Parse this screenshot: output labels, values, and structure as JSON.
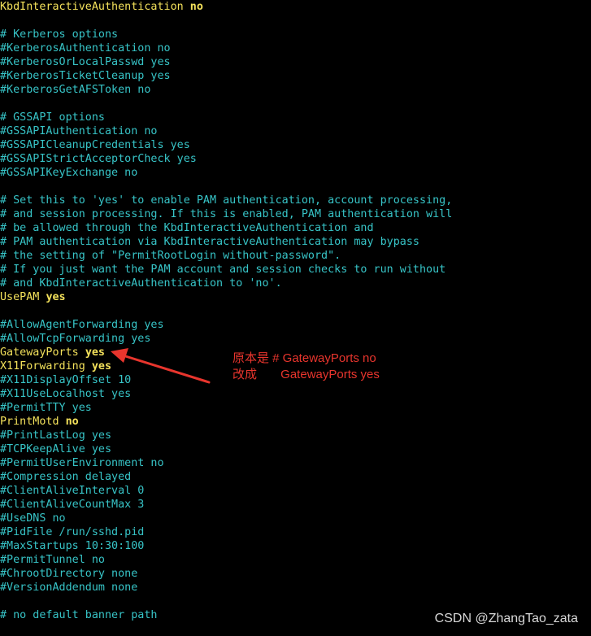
{
  "lines": [
    {
      "type": "directive",
      "key": "KbdInteractiveAuthentication",
      "val": "no"
    },
    {
      "type": "blank",
      "text": ""
    },
    {
      "type": "comment",
      "text": "# Kerberos options"
    },
    {
      "type": "comment",
      "text": "#KerberosAuthentication no"
    },
    {
      "type": "comment",
      "text": "#KerberosOrLocalPasswd yes"
    },
    {
      "type": "comment",
      "text": "#KerberosTicketCleanup yes"
    },
    {
      "type": "comment",
      "text": "#KerberosGetAFSToken no"
    },
    {
      "type": "blank",
      "text": ""
    },
    {
      "type": "comment",
      "text": "# GSSAPI options"
    },
    {
      "type": "comment",
      "text": "#GSSAPIAuthentication no"
    },
    {
      "type": "comment",
      "text": "#GSSAPICleanupCredentials yes"
    },
    {
      "type": "comment",
      "text": "#GSSAPIStrictAcceptorCheck yes"
    },
    {
      "type": "comment",
      "text": "#GSSAPIKeyExchange no"
    },
    {
      "type": "blank",
      "text": ""
    },
    {
      "type": "comment",
      "text": "# Set this to 'yes' to enable PAM authentication, account processing,"
    },
    {
      "type": "comment",
      "text": "# and session processing. If this is enabled, PAM authentication will"
    },
    {
      "type": "comment",
      "text": "# be allowed through the KbdInteractiveAuthentication and"
    },
    {
      "type": "comment",
      "text": "# PAM authentication via KbdInteractiveAuthentication may bypass"
    },
    {
      "type": "comment",
      "text": "# the setting of \"PermitRootLogin without-password\"."
    },
    {
      "type": "comment",
      "text": "# If you just want the PAM account and session checks to run without"
    },
    {
      "type": "comment",
      "text": "# and KbdInteractiveAuthentication to 'no'."
    },
    {
      "type": "directive",
      "key": "UsePAM",
      "val": "yes"
    },
    {
      "type": "blank",
      "text": ""
    },
    {
      "type": "comment",
      "text": "#AllowAgentForwarding yes"
    },
    {
      "type": "comment",
      "text": "#AllowTcpForwarding yes"
    },
    {
      "type": "directive",
      "key": "GatewayPorts",
      "val": "yes"
    },
    {
      "type": "directive",
      "key": "X11Forwarding",
      "val": "yes"
    },
    {
      "type": "comment",
      "text": "#X11DisplayOffset 10"
    },
    {
      "type": "comment",
      "text": "#X11UseLocalhost yes"
    },
    {
      "type": "comment",
      "text": "#PermitTTY yes"
    },
    {
      "type": "directive",
      "key": "PrintMotd",
      "val": "no"
    },
    {
      "type": "comment",
      "text": "#PrintLastLog yes"
    },
    {
      "type": "comment",
      "text": "#TCPKeepAlive yes"
    },
    {
      "type": "comment",
      "text": "#PermitUserEnvironment no"
    },
    {
      "type": "comment",
      "text": "#Compression delayed"
    },
    {
      "type": "comment",
      "text": "#ClientAliveInterval 0"
    },
    {
      "type": "comment",
      "text": "#ClientAliveCountMax 3"
    },
    {
      "type": "comment",
      "text": "#UseDNS no"
    },
    {
      "type": "comment",
      "text": "#PidFile /run/sshd.pid"
    },
    {
      "type": "comment",
      "text": "#MaxStartups 10:30:100"
    },
    {
      "type": "comment",
      "text": "#PermitTunnel no"
    },
    {
      "type": "comment",
      "text": "#ChrootDirectory none"
    },
    {
      "type": "comment",
      "text": "#VersionAddendum none"
    },
    {
      "type": "blank",
      "text": ""
    },
    {
      "type": "comment",
      "text": "# no default banner path"
    }
  ],
  "annotation": {
    "line1": "原本是 # GatewayPorts no",
    "line2": "改成       GatewayPorts yes",
    "color": "#e8352d"
  },
  "watermark": "CSDN @ZhangTao_zata",
  "colors": {
    "background": "#000000",
    "comment": "#37c4c7",
    "directive": "#f3e15b"
  }
}
